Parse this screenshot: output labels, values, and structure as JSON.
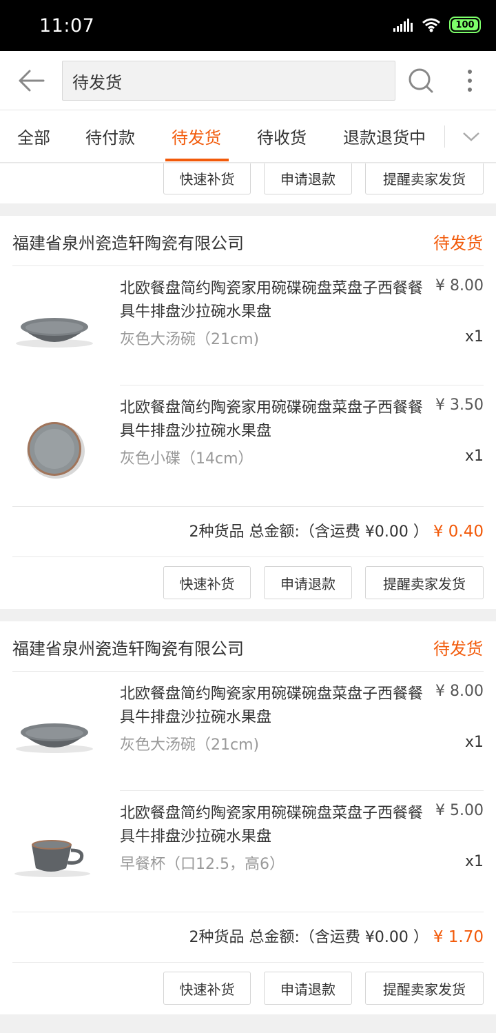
{
  "status_bar": {
    "time": "11:07",
    "battery": "100"
  },
  "search": {
    "value": "待发货"
  },
  "tabs": [
    {
      "label": "全部"
    },
    {
      "label": "待付款"
    },
    {
      "label": "待发货"
    },
    {
      "label": "待收货"
    },
    {
      "label": "退款退货中"
    }
  ],
  "actions": {
    "restock": "快速补货",
    "refund": "申请退款",
    "remind": "提醒卖家发货"
  },
  "orders": [
    {
      "shop": "福建省泉州瓷造轩陶瓷有限公司",
      "status": "待发货",
      "items": [
        {
          "title": "北欧餐盘简约陶瓷家用碗碟碗盘菜盘子西餐餐具牛排盘沙拉碗水果盘",
          "spec": "灰色大汤碗（21cm)",
          "price": "¥ 8.00",
          "qty": "x1",
          "thumb": "bowl-icon"
        },
        {
          "title": "北欧餐盘简约陶瓷家用碗碟碗盘菜盘子西餐餐具牛排盘沙拉碗水果盘",
          "spec": "灰色小碟（14cm）",
          "price": "¥ 3.50",
          "qty": "x1",
          "thumb": "plate-icon"
        }
      ],
      "summary": {
        "text": "2种货品 总金额:（含运费 ¥0.00 ）",
        "amount": "¥ 0.40"
      }
    },
    {
      "shop": "福建省泉州瓷造轩陶瓷有限公司",
      "status": "待发货",
      "items": [
        {
          "title": "北欧餐盘简约陶瓷家用碗碟碗盘菜盘子西餐餐具牛排盘沙拉碗水果盘",
          "spec": "灰色大汤碗（21cm)",
          "price": "¥ 8.00",
          "qty": "x1",
          "thumb": "bowl-icon"
        },
        {
          "title": "北欧餐盘简约陶瓷家用碗碟碗盘菜盘子西餐餐具牛排盘沙拉碗水果盘",
          "spec": "早餐杯（口12.5，高6）",
          "price": "¥ 5.00",
          "qty": "x1",
          "thumb": "cup-icon"
        }
      ],
      "summary": {
        "text": "2种货品 总金额:（含运费 ¥0.00 ）",
        "amount": "¥ 1.70"
      }
    }
  ],
  "colors": {
    "accent": "#f25a0a",
    "status_bar": "#000000",
    "battery": "#7dff6a"
  }
}
